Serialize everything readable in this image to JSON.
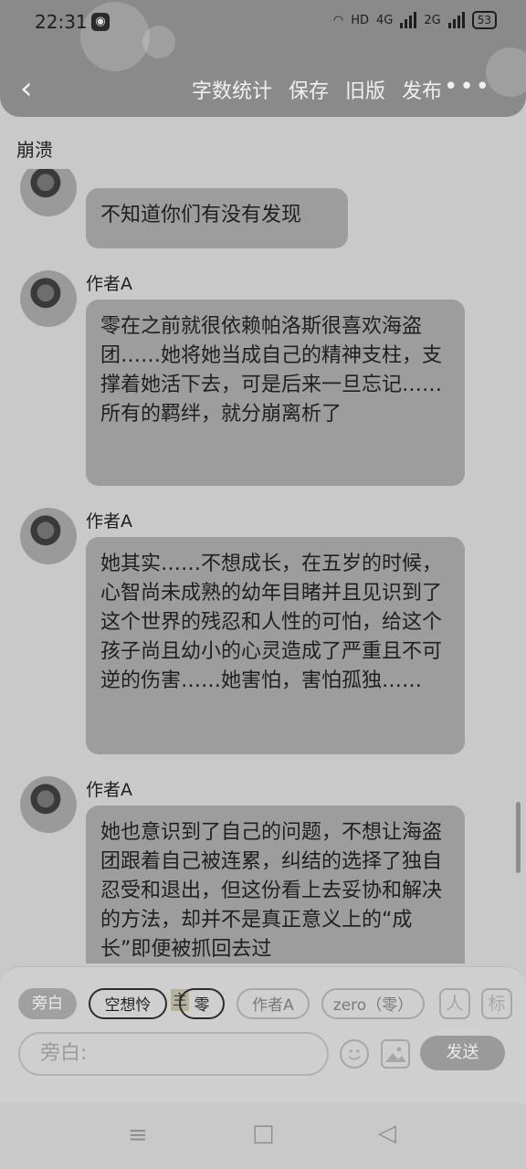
{
  "status_bar": {
    "time": "22:31",
    "hd": "HD",
    "net1": "4G",
    "net2": "2G",
    "battery": "53"
  },
  "header": {
    "menu": [
      "字数统计",
      "保存",
      "旧版",
      "发布"
    ],
    "more": "•••"
  },
  "chapter_title": "崩溃",
  "messages": [
    {
      "name": "",
      "text": "不知道你们有没有发现"
    },
    {
      "name": "作者A",
      "text": "零在之前就很依赖帕洛斯很喜欢海盗团……她将她当成自己的精神支柱，支撑着她活下去，可是后来一旦忘记……所有的羁绊，就分崩离析了"
    },
    {
      "name": "作者A",
      "text": "她其实……不想成长，在五岁的时候，心智尚未成熟的幼年目睹并且见识到了这个世界的残忍和人性的可怕，给这个孩子尚且幼小的心灵造成了严重且不可逆的伤害……她害怕，害怕孤独……"
    },
    {
      "name": "作者A",
      "text": "她也意识到了自己的问题，不想让海盗团跟着自己被连累，纠结的选择了独自忍受和退出，但这份看上去妥协和解决的方法，却并不是真正意义上的“成长”即便被抓回去过"
    }
  ],
  "role_chips": [
    "旁白",
    "空想怜",
    "零",
    "作者A",
    "zero（零）"
  ],
  "main_badge": "主",
  "icons": {
    "profile": "人",
    "tag": "标"
  },
  "composer": {
    "placeholder": "旁白:",
    "send": "发送"
  },
  "nav": {
    "menu": "≡",
    "home": "□",
    "back": "◁"
  }
}
